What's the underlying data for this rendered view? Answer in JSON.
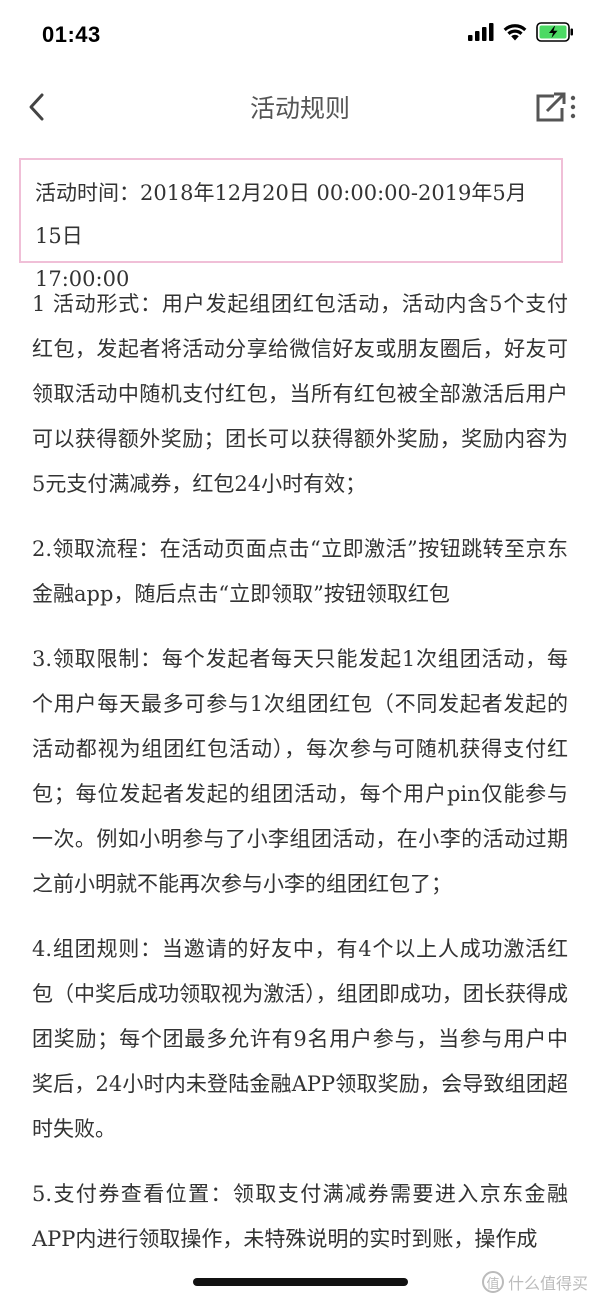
{
  "status_bar": {
    "time": "01:43",
    "icons": [
      "signal-icon",
      "wifi-icon",
      "battery-charging-icon"
    ],
    "battery_color": "#4cd964"
  },
  "nav": {
    "title": "活动规则",
    "back_icon": "chevron-left-icon",
    "share_icon": "share-icon"
  },
  "activity_time": {
    "line1": "活动时间：2018年12月20日 00:00:00-2019年5月15日",
    "line2": "17:00:00"
  },
  "rules": [
    "1 活动形式：用户发起组团红包活动，活动内含5个支付红包，发起者将活动分享给微信好友或朋友圈后，好友可领取活动中随机支付红包，当所有红包被全部激活后用户可以获得额外奖励；团长可以获得额外奖励，奖励内容为5元支付满减券，红包24小时有效；",
    "2.领取流程：在活动页面点击“立即激活”按钮跳转至京东金融app，随后点击“立即领取”按钮领取红包",
    "3.领取限制：每个发起者每天只能发起1次组团活动，每个用户每天最多可参与1次组团红包（不同发起者发起的活动都视为组团红包活动），每次参与可随机获得支付红包；每位发起者发起的组团活动，每个用户pin仅能参与一次。例如小明参与了小李组团活动，在小李的活动过期之前小明就不能再次参与小李的组团红包了；",
    "4.组团规则：当邀请的好友中，有4个以上人成功激活红包（中奖后成功领取视为激活），组团即成功，团长获得成团奖励；每个团最多允许有9名用户参与，当参与用户中奖后，24小时内未登陆金融APP领取奖励，会导致组团超时失败。",
    "5.支付券查看位置：领取支付满减券需要进入京东金融APP内进行领取操作，未特殊说明的实时到账，操作成"
  ],
  "watermark": {
    "icon": "zhi-icon",
    "text": "什么值得买"
  }
}
